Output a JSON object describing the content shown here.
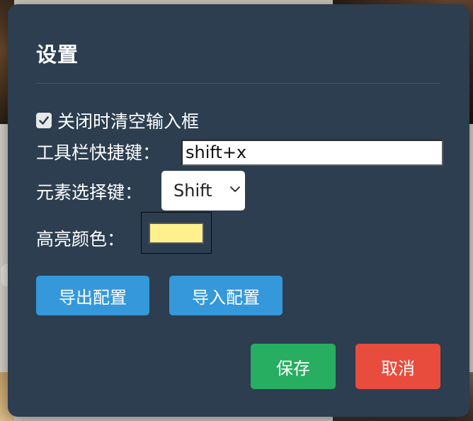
{
  "dialog": {
    "title": "设置",
    "clear_on_close": {
      "label": "关闭时清空输入框",
      "checked": true
    },
    "toolbar_hotkey": {
      "label": "工具栏快捷键：",
      "value": "shift+x"
    },
    "element_select_key": {
      "label": "元素选择键：",
      "selected": "Shift"
    },
    "highlight_color": {
      "label": "高亮颜色：",
      "value": "#fff08e"
    },
    "buttons": {
      "export": "导出配置",
      "import": "导入配置",
      "save": "保存",
      "cancel": "取消"
    }
  },
  "colors": {
    "dialog_bg": "#2c3e50",
    "primary": "#3498db",
    "success": "#27ae60",
    "danger": "#e74c3c"
  }
}
